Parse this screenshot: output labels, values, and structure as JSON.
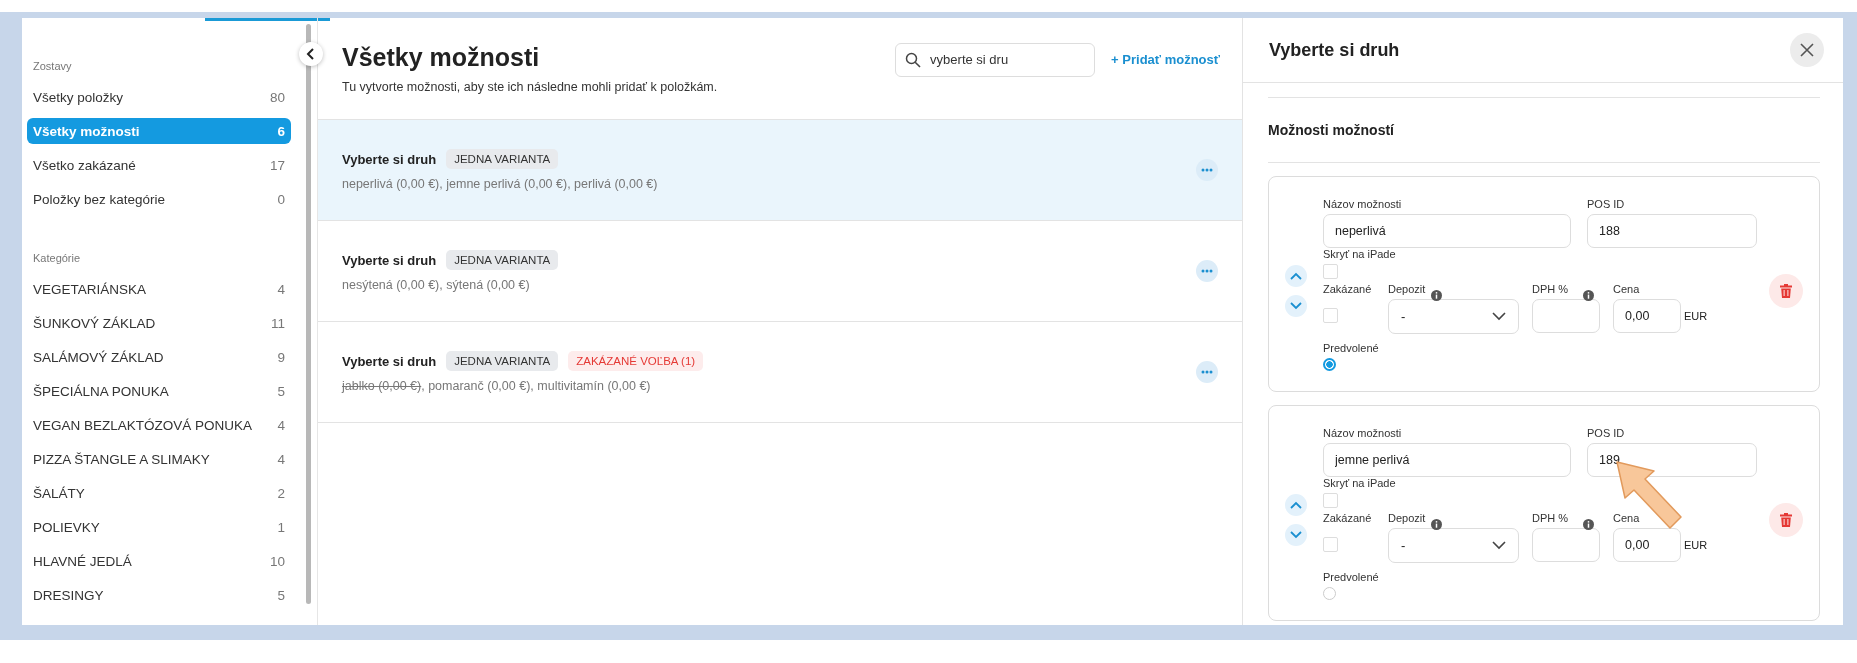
{
  "sidebar": {
    "sections": [
      {
        "heading": "Zostavy",
        "items": [
          {
            "label": "Všetky položky",
            "count": "80",
            "selected": false
          },
          {
            "label": "Všetky možnosti",
            "count": "6",
            "selected": true
          },
          {
            "label": "Všetko zakázané",
            "count": "17",
            "selected": false
          },
          {
            "label": "Položky bez kategórie",
            "count": "0",
            "selected": false
          }
        ]
      },
      {
        "heading": "Kategórie",
        "items": [
          {
            "label": "VEGETARIÁNSKA",
            "count": "4",
            "selected": false
          },
          {
            "label": "ŠUNKOVÝ ZÁKLAD",
            "count": "11",
            "selected": false
          },
          {
            "label": "SALÁMOVÝ ZÁKLAD",
            "count": "9",
            "selected": false
          },
          {
            "label": "ŠPECIÁLNA PONUKA",
            "count": "5",
            "selected": false
          },
          {
            "label": "VEGAN BEZLAKTÓZOVÁ PONUKA",
            "count": "4",
            "selected": false
          },
          {
            "label": "PIZZA ŠTANGLE A SLIMAKY",
            "count": "4",
            "selected": false
          },
          {
            "label": "ŠALÁTY",
            "count": "2",
            "selected": false
          },
          {
            "label": "POLIEVKY",
            "count": "1",
            "selected": false
          },
          {
            "label": "HLAVNÉ JEDLÁ",
            "count": "10",
            "selected": false
          },
          {
            "label": "DRESINGY",
            "count": "5",
            "selected": false
          }
        ]
      }
    ]
  },
  "main": {
    "title": "Všetky možnosti",
    "subtitle": "Tu vytvorte možnosti, aby ste ich následne mohli pridať k položkám.",
    "search": {
      "value": "vyberte si dru"
    },
    "add_button": "+ Pridať možnosť",
    "groups": [
      {
        "name": "Vyberte si druh",
        "selected": true,
        "separator": ", ",
        "tags": [
          {
            "label": "JEDNA VARIANTA",
            "kind": "neutral"
          }
        ],
        "options": [
          {
            "text": "neperlivá (0,00 €)",
            "disabled": false
          },
          {
            "text": "jemne perlivá (0,00 €)",
            "disabled": false
          },
          {
            "text": "perlivá (0,00 €)",
            "disabled": false
          }
        ]
      },
      {
        "name": "Vyberte si druh",
        "selected": false,
        "separator": ", ",
        "tags": [
          {
            "label": "JEDNA VARIANTA",
            "kind": "neutral"
          }
        ],
        "options": [
          {
            "text": "nesýtená (0,00 €)",
            "disabled": false
          },
          {
            "text": "sýtená (0,00 €)",
            "disabled": false
          }
        ]
      },
      {
        "name": "Vyberte si druh",
        "selected": false,
        "separator": ", ",
        "tags": [
          {
            "label": "JEDNA VARIANTA",
            "kind": "neutral"
          },
          {
            "label": "ZAKÁZANÉ VOĽBA (1)",
            "kind": "danger"
          }
        ],
        "options": [
          {
            "text": "jablko (0,00 €)",
            "disabled": true
          },
          {
            "text": "pomaranč (0,00 €)",
            "disabled": false
          },
          {
            "text": "multivitamín (0,00 €)",
            "disabled": false
          }
        ]
      }
    ]
  },
  "detail": {
    "title": "Vyberte si druh",
    "section_title": "Možnosti možností",
    "options": [
      {
        "name_label": "Názov možnosti",
        "name": "neperlivá",
        "pos_label": "POS ID",
        "pos_id": "188",
        "hide_label": "Skryť na iPade",
        "hidden": false,
        "disabled_label": "Zakázané",
        "disabled": false,
        "deposit_label": "Depozit",
        "deposit": "-",
        "vat_label": "DPH %",
        "price_label": "Cena",
        "price": "0,00",
        "currency": "EUR",
        "default_label": "Predvolené",
        "default": true
      },
      {
        "name_label": "Názov možnosti",
        "name": "jemne perlivá",
        "pos_label": "POS ID",
        "pos_id": "189",
        "hide_label": "Skryť na iPade",
        "hidden": false,
        "disabled_label": "Zakázané",
        "disabled": false,
        "deposit_label": "Depozit",
        "deposit": "-",
        "vat_label": "DPH %",
        "price_label": "Cena",
        "price": "0,00",
        "currency": "EUR",
        "default_label": "Predvolené",
        "default": false
      }
    ]
  }
}
